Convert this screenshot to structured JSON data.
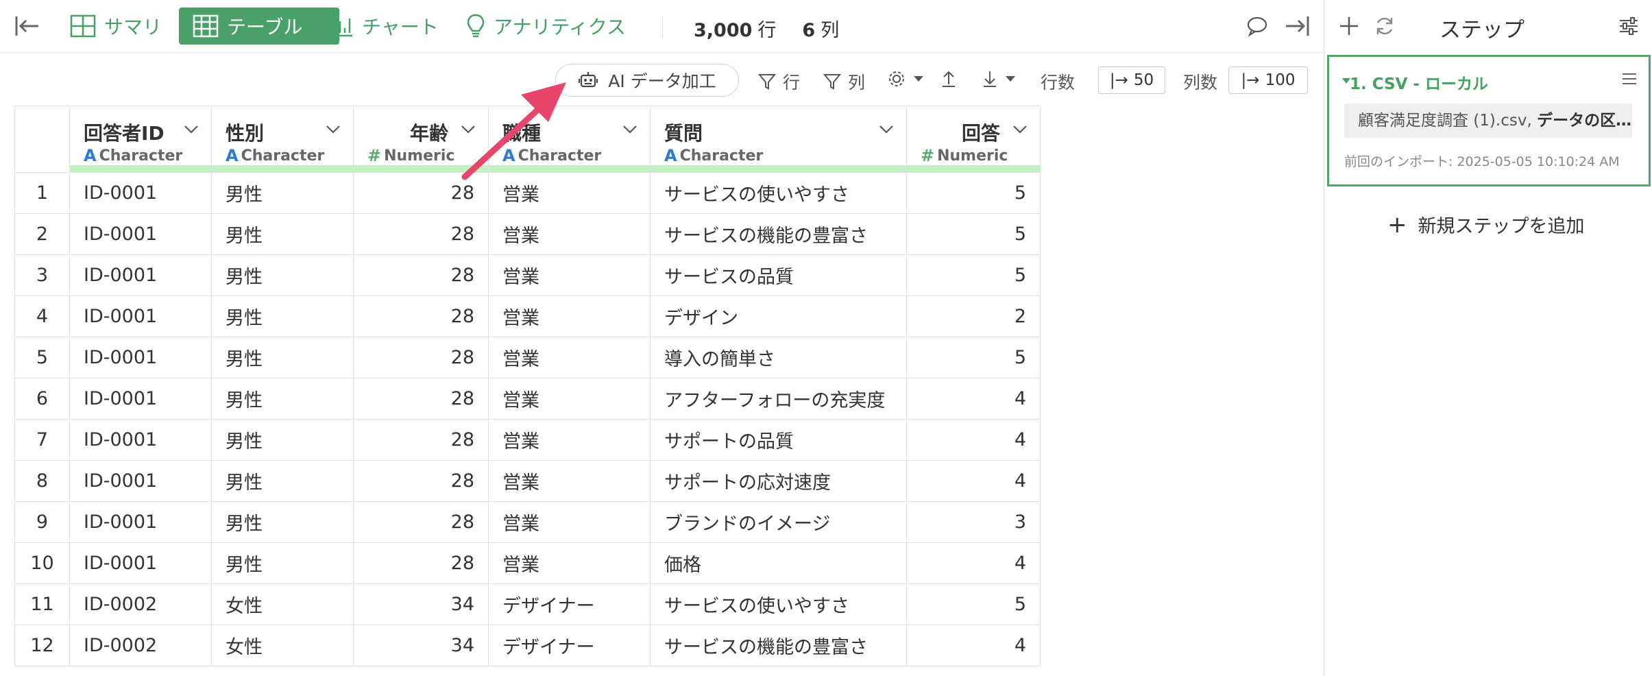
{
  "tabs": [
    {
      "label": "サマリ",
      "active": false,
      "icon": "summary-icon"
    },
    {
      "label": "テーブル",
      "active": true,
      "icon": "table-icon"
    },
    {
      "label": "チャート",
      "active": false,
      "icon": "bar-chart-icon"
    },
    {
      "label": "アナリティクス",
      "active": false,
      "icon": "lightbulb-icon"
    }
  ],
  "counts": {
    "rows": "3,000",
    "rows_unit": "行",
    "cols": "6",
    "cols_unit": "列"
  },
  "toolbar": {
    "ai_label": "AI データ加工",
    "row_filter": "行",
    "col_filter": "列",
    "rows_label": "行数",
    "rows_value": "50",
    "cols_label": "列数",
    "cols_value": "100"
  },
  "columns": [
    {
      "name": "回答者ID",
      "type": "Character",
      "kind": "char"
    },
    {
      "name": "性別",
      "type": "Character",
      "kind": "char"
    },
    {
      "name": "年齢",
      "type": "Numeric",
      "kind": "num"
    },
    {
      "name": "職種",
      "type": "Character",
      "kind": "char"
    },
    {
      "name": "質問",
      "type": "Character",
      "kind": "char"
    },
    {
      "name": "回答",
      "type": "Numeric",
      "kind": "num"
    }
  ],
  "rows": [
    [
      "1",
      "ID-0001",
      "男性",
      "28",
      "営業",
      "サービスの使いやすさ",
      "5"
    ],
    [
      "2",
      "ID-0001",
      "男性",
      "28",
      "営業",
      "サービスの機能の豊富さ",
      "5"
    ],
    [
      "3",
      "ID-0001",
      "男性",
      "28",
      "営業",
      "サービスの品質",
      "5"
    ],
    [
      "4",
      "ID-0001",
      "男性",
      "28",
      "営業",
      "デザイン",
      "2"
    ],
    [
      "5",
      "ID-0001",
      "男性",
      "28",
      "営業",
      "導入の簡単さ",
      "5"
    ],
    [
      "6",
      "ID-0001",
      "男性",
      "28",
      "営業",
      "アフターフォローの充実度",
      "4"
    ],
    [
      "7",
      "ID-0001",
      "男性",
      "28",
      "営業",
      "サポートの品質",
      "4"
    ],
    [
      "8",
      "ID-0001",
      "男性",
      "28",
      "営業",
      "サポートの応対速度",
      "4"
    ],
    [
      "9",
      "ID-0001",
      "男性",
      "28",
      "営業",
      "ブランドのイメージ",
      "3"
    ],
    [
      "10",
      "ID-0001",
      "男性",
      "28",
      "営業",
      "価格",
      "4"
    ],
    [
      "11",
      "ID-0002",
      "女性",
      "34",
      "デザイナー",
      "サービスの使いやすさ",
      "5"
    ],
    [
      "12",
      "ID-0002",
      "女性",
      "34",
      "デザイナー",
      "サービスの機能の豊富さ",
      "4"
    ]
  ],
  "sidebar": {
    "title": "ステップ",
    "step": {
      "title": "1. CSV - ローカル",
      "file": "顧客満足度調査 (1).csv, ",
      "file_bold": "データの区…",
      "timestamp": "前回のインポート: 2025-05-05 10:10:24 AM"
    },
    "add_step": "新規ステップを追加"
  },
  "colors": {
    "accent": "#4aa168",
    "quality_bar": "#c5efc0",
    "arrow": "#e8456b"
  }
}
